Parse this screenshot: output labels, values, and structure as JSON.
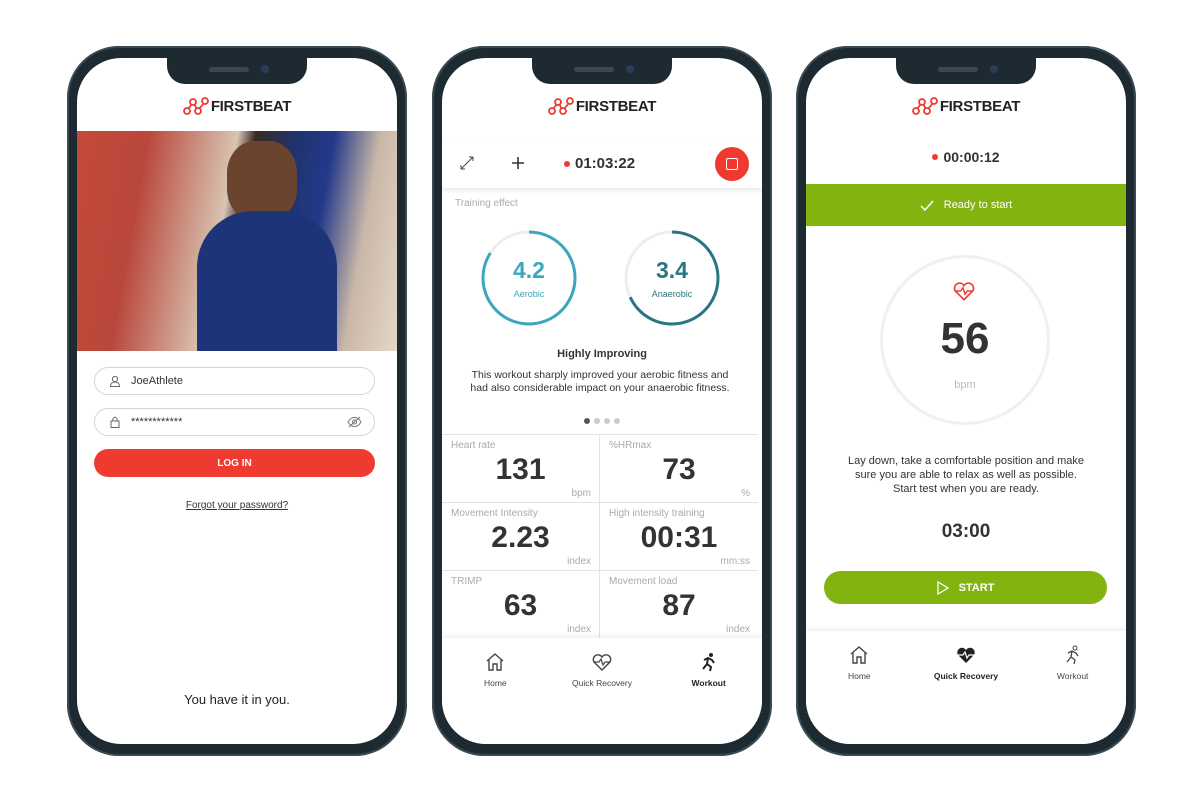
{
  "brand": {
    "name": "FIRSTBEAT",
    "accent": "#ee3a2f",
    "green": "#82b30f",
    "teal": "#3aa7bd",
    "dark_teal": "#2a7583"
  },
  "login": {
    "username_value": "JoeAthlete",
    "password_value": "************",
    "username_icon": "user-icon",
    "password_icon": "lock-icon",
    "visibility_icon": "eye-off-icon",
    "login_label": "LOG IN",
    "forgot_label": "Forgot your password?",
    "tagline": "You have it in you."
  },
  "workout": {
    "timer": "01:03:22",
    "section_label": "Training effect",
    "aerobic": {
      "value": "4.2",
      "label": "Aerobic",
      "progress": 0.84
    },
    "anaerobic": {
      "value": "3.4",
      "label": "Anaerobic",
      "progress": 0.68
    },
    "effect_title": "Highly Improving",
    "effect_description": "This workout sharply improved your aerobic fitness and had also considerable impact on your anaerobic fitness.",
    "page_dots": {
      "count": 4,
      "active": 0
    },
    "metrics": [
      {
        "label": "Heart rate",
        "value": "131",
        "unit": "bpm"
      },
      {
        "label": "%HRmax",
        "value": "73",
        "unit": "%"
      },
      {
        "label": "Movement Intensity",
        "value": "2.23",
        "unit": "index"
      },
      {
        "label": "High intensity training",
        "value": "00:31",
        "unit": "mm:ss"
      },
      {
        "label": "TRIMP",
        "value": "63",
        "unit": "index"
      },
      {
        "label": "Movement load",
        "value": "87",
        "unit": "index"
      }
    ]
  },
  "recovery": {
    "timer": "00:00:12",
    "status": "Ready to start",
    "heart_rate": "56",
    "heart_unit": "bpm",
    "instructions": "Lay down, take a comfortable position and make sure you are able to relax as well as possible. Start test when you are ready.",
    "countdown": "03:00",
    "start_label": "START"
  },
  "nav": {
    "home": "Home",
    "recovery": "Quick Recovery",
    "workout": "Workout"
  }
}
